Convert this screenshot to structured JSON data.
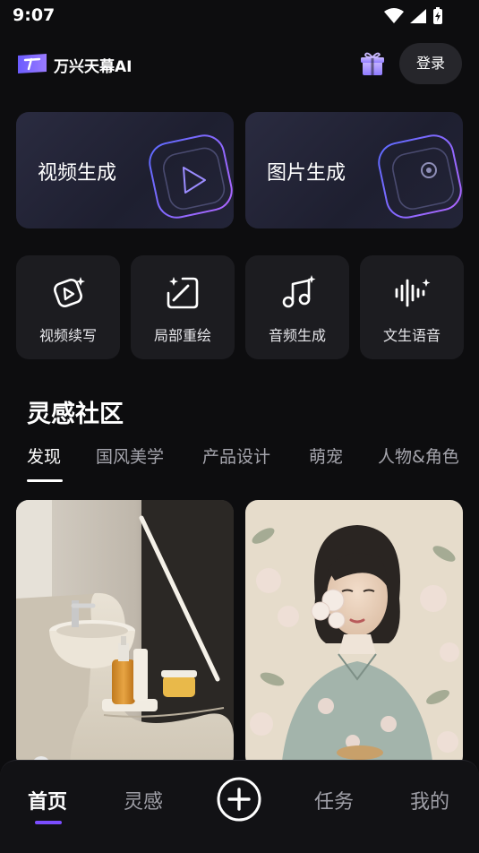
{
  "status_bar": {
    "time": "9:07"
  },
  "header": {
    "app_name": "万兴天幕AI",
    "login_label": "登录"
  },
  "feature_cards": [
    {
      "label": "视频生成"
    },
    {
      "label": "图片生成"
    }
  ],
  "tools": [
    {
      "label": "视频续写",
      "icon": "video-extend-icon"
    },
    {
      "label": "局部重绘",
      "icon": "inpaint-icon"
    },
    {
      "label": "音频生成",
      "icon": "music-note-icon"
    },
    {
      "label": "文生语音",
      "icon": "sound-wave-icon"
    }
  ],
  "community": {
    "title": "灵感社区",
    "tabs": [
      "发现",
      "国风美学",
      "产品设计",
      "萌宠",
      "人物&角色"
    ],
    "active_tab": "发现"
  },
  "bottom_nav": {
    "items": [
      "首页",
      "灵感",
      "任务",
      "我的"
    ],
    "active": "首页"
  },
  "colors": {
    "background": "#0d0d0f",
    "accent": "#7b4dff",
    "card": "#1c1c20"
  }
}
